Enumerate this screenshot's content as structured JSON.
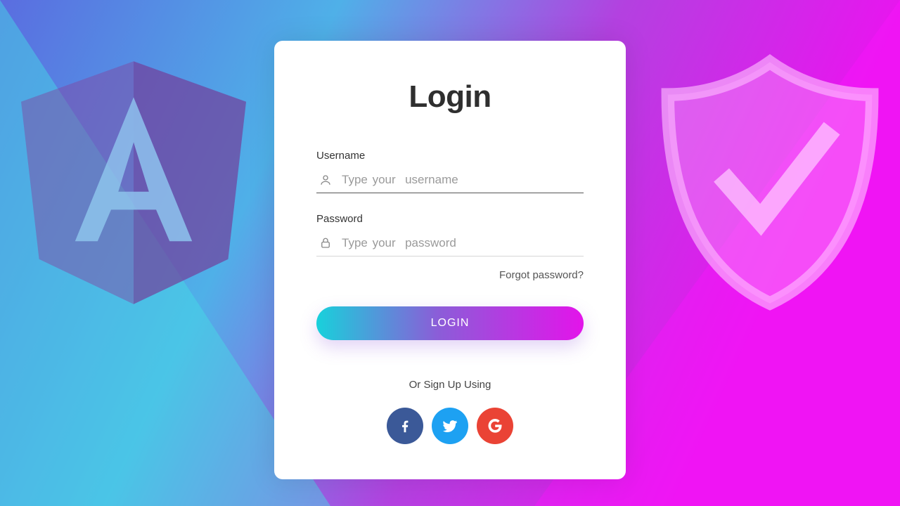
{
  "title": "Login",
  "username": {
    "label": "Username",
    "placeholder": "Type your  username",
    "value": ""
  },
  "password": {
    "label": "Password",
    "placeholder": "Type your  password",
    "value": ""
  },
  "forgot": "Forgot password?",
  "login_button": "LOGIN",
  "signup_text": "Or Sign Up Using",
  "socials": {
    "facebook": "facebook",
    "twitter": "twitter",
    "google": "google"
  },
  "decor": {
    "left_logo": "angular-logo",
    "right_logo": "shield-check"
  }
}
